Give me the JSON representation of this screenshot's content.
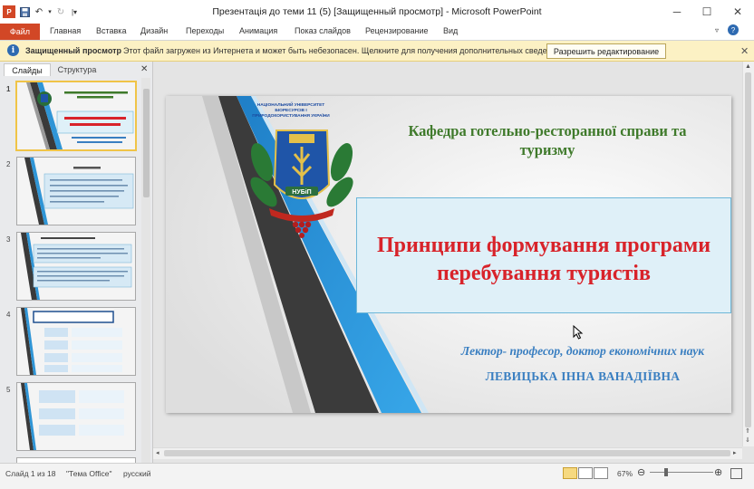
{
  "window": {
    "title": "Презентація до теми 11 (5) [Защищенный просмотр] - Microsoft PowerPoint",
    "minimize_icon": "minimize-icon",
    "maximize_icon": "maximize-icon",
    "close_icon": "close-icon"
  },
  "ribbon": {
    "file_label": "Файл",
    "tabs": [
      "Главная",
      "Вставка",
      "Дизайн",
      "Переходы",
      "Анимация",
      "Показ слайдов",
      "Рецензирование",
      "Вид"
    ]
  },
  "protected_view": {
    "title": "Защищенный просмотр",
    "message": "Этот файл загружен из Интернета и может быть небезопасен. Щелкните для получения дополнительных сведений.",
    "enable_button": "Разрешить редактирование",
    "info_glyph": "i"
  },
  "left_panel": {
    "tab_slides": "Слайды",
    "tab_outline": "Структура",
    "slide_numbers": [
      "1",
      "2",
      "3",
      "4",
      "5"
    ]
  },
  "slide": {
    "department": "Кафедра готельно-ресторанної справи та туризму",
    "title": "Принципи формування програми перебування туристів",
    "lecturer": "Лектор- професор, доктор економічних наук",
    "name": "ЛЕВИЦЬКА ІННА ВАНАДІЇВНА",
    "emblem_caption": "НАЦІОНАЛЬНИЙ УНІВЕРСИТЕТ БІОРЕСУРСІВ І ПРИРОДОКОРИСТУВАННЯ УКРАЇНИ",
    "emblem_badge": "НУБіП"
  },
  "status_bar": {
    "slide_info": "Слайд 1 из 18",
    "theme": "\"Тема Office\"",
    "language": "русский",
    "zoom": "67%"
  },
  "colors": {
    "file_tab": "#d24726",
    "protected_bar": "#fcf1c4",
    "slide_title": "#d8232a",
    "slide_department": "#3f7a2b",
    "slide_lecturer": "#3a7fc1"
  }
}
